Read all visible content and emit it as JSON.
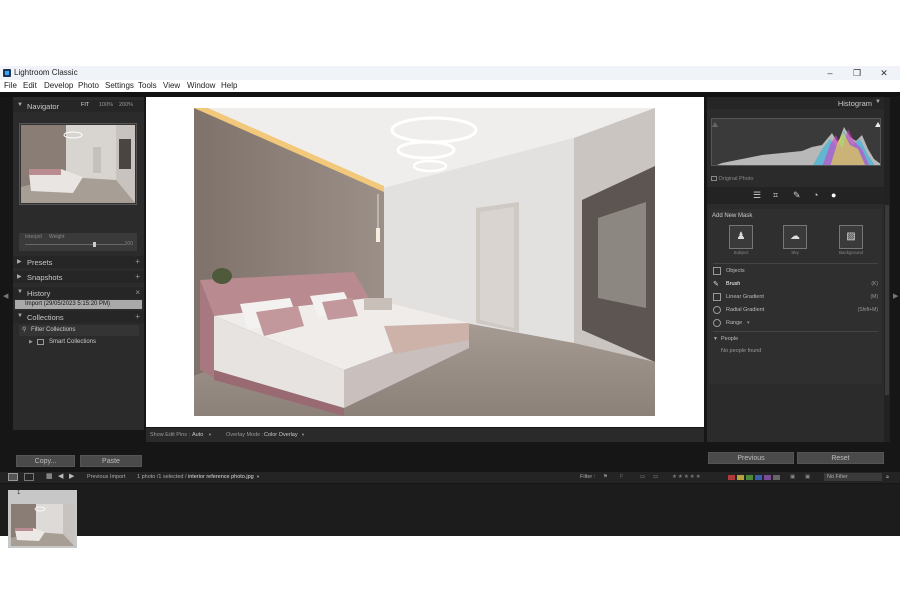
{
  "window": {
    "title": "Lightroom Classic",
    "minimize": "–",
    "maximize": "❐",
    "close": "✕"
  },
  "menu": [
    "File",
    "Edit",
    "Develop",
    "Photo",
    "Settings",
    "Tools",
    "View",
    "Window",
    "Help"
  ],
  "navigator": {
    "title": "Navigator",
    "zoom": [
      "FIT",
      "100%",
      "200%"
    ],
    "slider_labels": [
      "Interpol",
      "Weight"
    ],
    "slider_value": "100"
  },
  "left_sections": [
    {
      "label": "Presets"
    },
    {
      "label": "Snapshots"
    },
    {
      "label": "History"
    },
    {
      "label": "Collections"
    }
  ],
  "history_item": "Import (29/05/2023 5:15:20 PM)",
  "collections": {
    "filter": "Filter Collections",
    "smart": "Smart Collections"
  },
  "left_buttons": {
    "copy": "Copy...",
    "paste": "Paste"
  },
  "center_toolbar": {
    "show_edit_pins_label": "Show Edit Pins :",
    "show_edit_pins_value": "Auto",
    "overlay_mode_label": "Overlay Mode :",
    "overlay_mode_value": "Color Overlay"
  },
  "histogram": {
    "title": "Histogram",
    "original_photo": "Original Photo"
  },
  "masking": {
    "title": "Add New Mask",
    "buttons": [
      {
        "label": "Subject",
        "icon": "subject-icon"
      },
      {
        "label": "Sky",
        "icon": "sky-icon"
      },
      {
        "label": "Background",
        "icon": "background-icon"
      }
    ],
    "tools": [
      {
        "label": "Objects",
        "key": "",
        "icon": "objects-icon"
      },
      {
        "label": "Brush",
        "key": "(K)",
        "icon": "brush-icon"
      },
      {
        "label": "Linear Gradient",
        "key": "(M)",
        "icon": "linear-gradient-icon"
      },
      {
        "label": "Radial Gradient",
        "key": "(Shift+M)",
        "icon": "radial-gradient-icon"
      },
      {
        "label": "Range",
        "key": "",
        "icon": "range-icon"
      }
    ],
    "people_title": "People",
    "people_empty": "No people found"
  },
  "right_buttons": {
    "previous": "Previous",
    "reset": "Reset"
  },
  "filmstrip_bar": {
    "source": "Previous Import",
    "count": "1 photo /1 selected /",
    "filename": "interior reference photo.jpg",
    "filter_label": "Filter :",
    "filter_value": "No Filter"
  },
  "filmstrip": {
    "thumb_number": "1"
  },
  "colors": {
    "label_red": "#b03a3a",
    "label_yellow": "#b5a23a",
    "label_green": "#4a8a3a",
    "label_blue": "#3a5ea8",
    "label_purple": "#7a4a9a"
  }
}
